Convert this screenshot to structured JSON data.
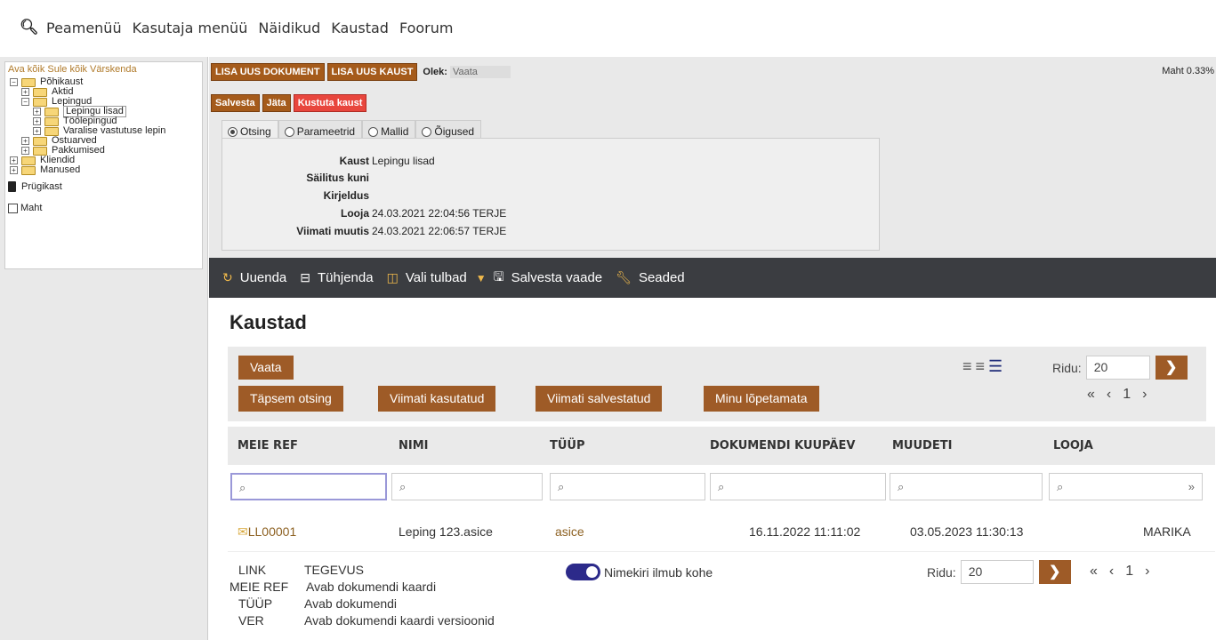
{
  "topnav": {
    "items": [
      "Peamenüü",
      "Kasutaja menüü",
      "Näidikud",
      "Kaustad",
      "Foorum"
    ]
  },
  "tree": {
    "actions": [
      "Ava kõik",
      "Sule kõik",
      "Värskenda"
    ],
    "nodes": [
      "Põhikaust",
      "Aktid",
      "Lepingud",
      "Lepingu lisad",
      "Töölepingud",
      "Varalise vastutuse lepin",
      "Ostuarved",
      "Pakkumised",
      "Kliendid",
      "Manused"
    ],
    "trash": "Prügikast",
    "maht": "Maht"
  },
  "toolbar": {
    "new_doc": "LISA UUS DOKUMENT",
    "new_folder": "LISA UUS KAUST",
    "olek_label": "Olek:",
    "olek_value": "Vaata",
    "maht": "Maht 0.33%",
    "save": "Salvesta",
    "leave": "Jäta",
    "delete": "Kustuta kaust"
  },
  "tabs": [
    "Otsing",
    "Parameetrid",
    "Mallid",
    "Õigused"
  ],
  "info": {
    "kaust_label": "Kaust",
    "kaust_value": "Lepingu lisad",
    "sailitus_label": "Säilitus kuni",
    "sailitus_value": "",
    "kirjeldus_label": "Kirjeldus",
    "kirjeldus_value": "",
    "looja_label": "Looja",
    "looja_value": "24.03.2021 22:04:56 TERJE",
    "muutis_label": "Viimati muutis",
    "muutis_value": "24.03.2021 22:06:57 TERJE"
  },
  "darkbar": {
    "refresh": "Uuenda",
    "clear": "Tühjenda",
    "columns": "Vali tulbad",
    "save_view": "Salvesta vaade",
    "settings": "Seaded"
  },
  "main": {
    "title": "Kaustad",
    "btn_view": "Vaata",
    "btn_advanced": "Täpsem otsing",
    "btn_recent": "Viimati kasutatud",
    "btn_saved": "Viimati salvestatud",
    "btn_unfinished": "Minu lõpetamata",
    "ridu_label": "Ridu:",
    "ridu_value": "20",
    "page": "1"
  },
  "table": {
    "headers": [
      "MEIE REF",
      "NIMI",
      "TÜÜP",
      "DOKUMENDI KUUPÄEV",
      "MUUDETI",
      "LOOJA"
    ],
    "row": {
      "ref": "LL00001",
      "nimi": "Leping 123.asice",
      "tyyp": "asice",
      "kuupaev": "16.11.2022 11:11:02",
      "muudeti": "03.05.2023 11:30:13",
      "looja": "MARIKA"
    }
  },
  "legend": {
    "head_k": "LINK",
    "head_v": "TEGEVUS",
    "r1_k": "MEIE REF",
    "r1_v": "Avab dokumendi kaardi",
    "r2_k": "TÜÜP",
    "r2_v": "Avab dokumendi",
    "r3_k": "VER",
    "r3_v": "Avab dokumendi kaardi versioonid",
    "toggle": "Nimekiri ilmub kohe",
    "ridu_label": "Ridu:",
    "ridu_value": "20",
    "page": "1"
  }
}
